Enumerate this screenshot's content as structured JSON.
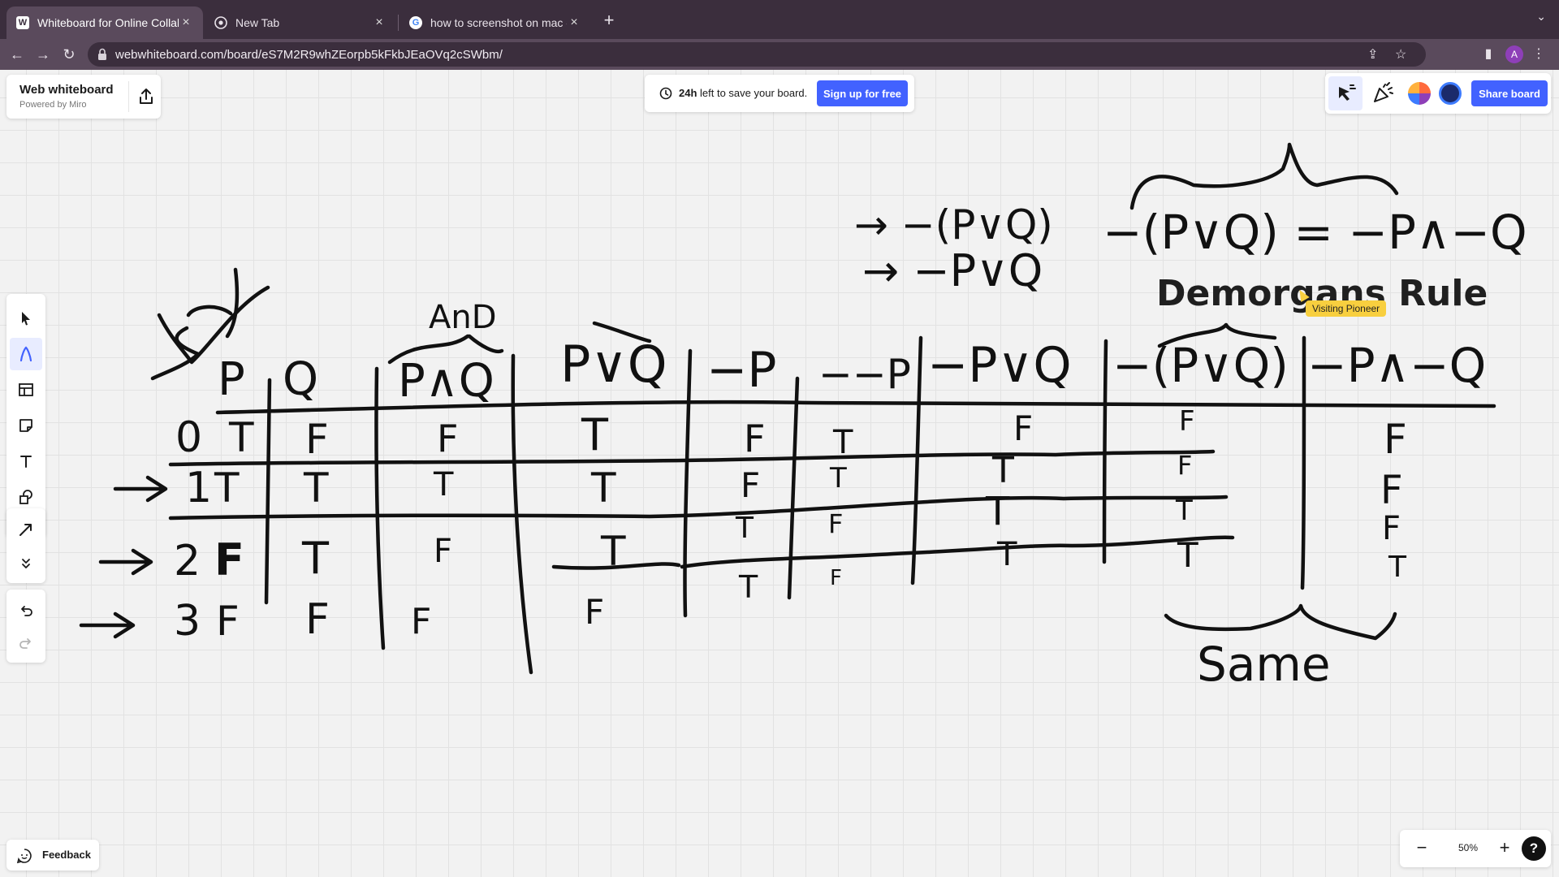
{
  "browser": {
    "tabs": [
      {
        "title": "Whiteboard for Online Collabo",
        "favicon": "W"
      },
      {
        "title": "New Tab",
        "favicon": ""
      },
      {
        "title": "how to screenshot on mac - G",
        "favicon": "G"
      }
    ],
    "url": "webwhiteboard.com/board/eS7M2R9whZEorpb5kFkbJEaOVq2cSWbm/",
    "profile_initial": "A"
  },
  "app": {
    "brand_name": "Web whiteboard",
    "brand_sub": "Powered by Miro",
    "save_hours": "24h",
    "save_rest": " left to save your board.",
    "signup_label": "Sign up for free",
    "share_label": "Share board",
    "feedback_label": "Feedback",
    "zoom_level": "50%",
    "help_label": "?"
  },
  "board": {
    "title_text": "Demorgans Rule",
    "cursor_label": "Visiting Pioneer",
    "handwriting": {
      "column_headers": [
        "P",
        "Q",
        "P∧Q",
        "P∨Q",
        "−P",
        "−−P",
        "−P∨Q",
        "−(P∨Q)",
        "−P∧−Q"
      ],
      "and_label": "AnD",
      "row_labels": [
        "0",
        "1",
        "2",
        "3"
      ],
      "rows": [
        [
          "T",
          "F",
          "F",
          "T",
          "F",
          "T",
          "F",
          "F",
          "F"
        ],
        [
          "T",
          "T",
          "T",
          "T",
          "F",
          "T",
          "T",
          "F",
          "F"
        ],
        [
          "F",
          "T",
          "F",
          "T",
          "T",
          "F",
          "T",
          "T",
          "F"
        ],
        [
          "F",
          "F",
          "F",
          "F",
          "T",
          "F",
          "T",
          "T",
          "T"
        ]
      ],
      "formula_1": "→ −(P∨Q)",
      "formula_2": "→ −P∨Q",
      "formula_rule": "−(P∨Q) = −P∧−Q",
      "same_label": "Same"
    }
  },
  "icons": {
    "reactions": "reactions-icon",
    "celebrate": "celebrate-icon",
    "export": "export-icon"
  },
  "colors": {
    "accent": "#4262ff",
    "chrome_dark": "#3b2e3d",
    "chrome": "#5a4a5c",
    "cursor_tag": "#f8cf3f"
  }
}
